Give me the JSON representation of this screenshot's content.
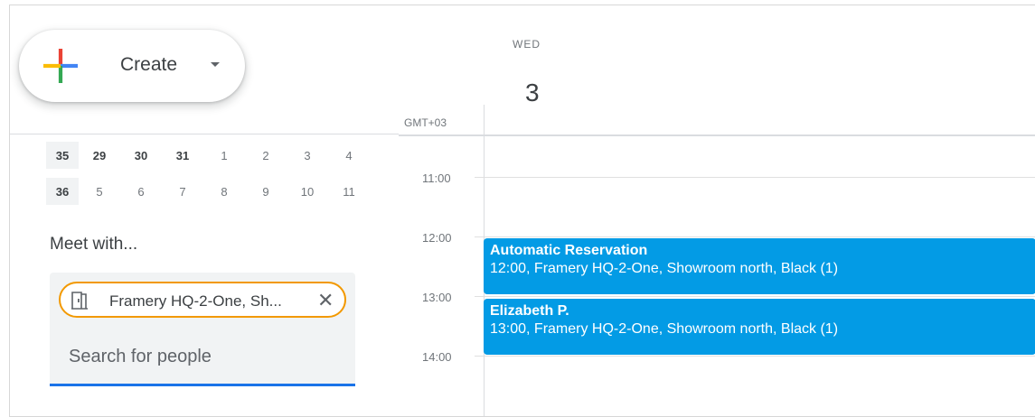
{
  "create": {
    "label": "Create"
  },
  "mini_calendar": {
    "rows": [
      {
        "week": "35",
        "days": [
          "29",
          "30",
          "31",
          "1",
          "2",
          "3",
          "4"
        ]
      },
      {
        "week": "36",
        "days": [
          "5",
          "6",
          "7",
          "8",
          "9",
          "10",
          "11"
        ]
      }
    ]
  },
  "meet_with": {
    "title": "Meet with...",
    "chip_label": "Framery HQ-2-One, Sh...",
    "search_placeholder": "Search for people"
  },
  "day_header": {
    "day_name": "WED",
    "day_number": "3",
    "timezone": "GMT+03"
  },
  "times": [
    "11:00",
    "12:00",
    "13:00",
    "14:00"
  ],
  "events": [
    {
      "title": "Automatic Reservation",
      "desc": "12:00, Framery HQ-2-One, Showroom north, Black (1)"
    },
    {
      "title": "Elizabeth P.",
      "desc": "13:00, Framery HQ-2-One, Showroom north, Black (1)"
    }
  ],
  "colors": {
    "event": "#039be5",
    "chip_border": "#f29900",
    "focus": "#1a73e8"
  }
}
